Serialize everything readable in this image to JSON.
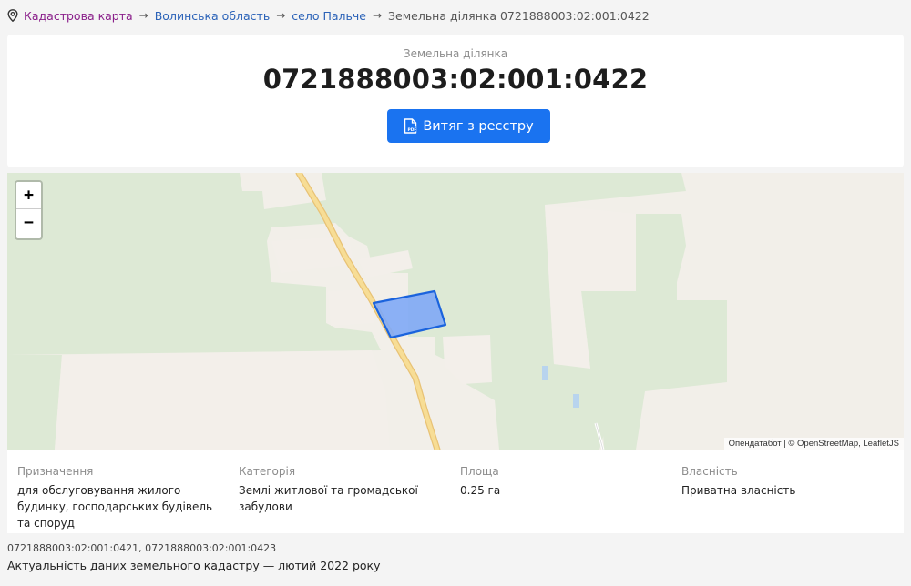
{
  "breadcrumb": {
    "items": [
      {
        "label": "Кадастрова карта"
      },
      {
        "label": "Волинська область"
      },
      {
        "label": "село Пальче"
      },
      {
        "label": "Земельна ділянка 0721888003:02:001:0422"
      }
    ],
    "separator": "→"
  },
  "parcel": {
    "label": "Земельна ділянка",
    "number": "0721888003:02:001:0422",
    "extract_button": "Витяг з реєстру"
  },
  "map": {
    "zoom_in": "+",
    "zoom_out": "−",
    "attribution": "Опендатабот | © OpenStreetMap, LeafletJS",
    "colors": {
      "background": "#f2efe9",
      "green": "#dde9d5",
      "road": "#f5d58a",
      "parcel_fill": "#7fa9f6",
      "parcel_stroke": "#1a63dd"
    }
  },
  "info": {
    "purpose": {
      "title": "Призначення",
      "value": "для обслуговування жилого будинку, господарських будівель та споруд"
    },
    "category": {
      "title": "Категорія",
      "value": "Землі житлової та громадської забудови"
    },
    "area": {
      "title": "Площа",
      "value": "0.25 га"
    },
    "ownership": {
      "title": "Власність",
      "value": "Приватна власність"
    }
  },
  "neighbors": "0721888003:02:001:0421, 0721888003:02:001:0423",
  "actuality": "Актуальність даних земельного кадастру — лютий 2022 року",
  "icons": {
    "breadcrumb": "map-pin-icon",
    "button": "pdf-file-icon"
  }
}
